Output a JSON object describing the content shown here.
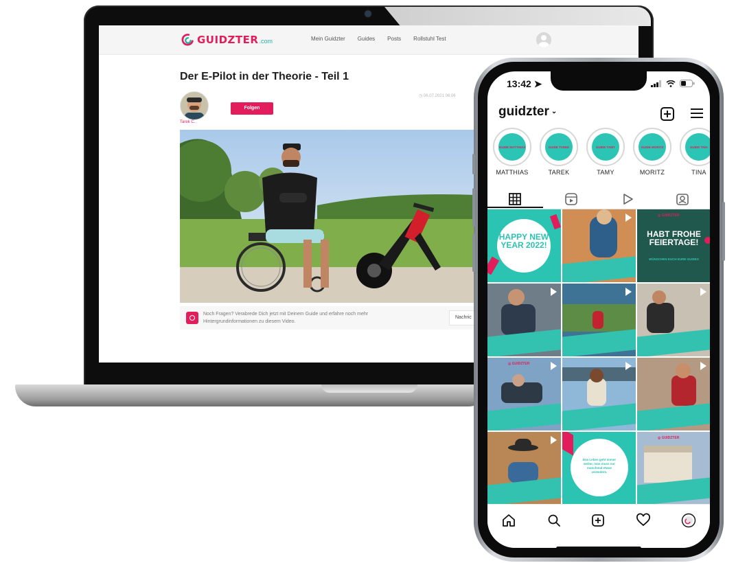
{
  "website": {
    "logo_text": "GUIDZTER",
    "logo_domain": ".com",
    "nav": [
      "Mein Guidzter",
      "Guides",
      "Posts",
      "Rollstuhl Test"
    ],
    "post_title": "Der E-Pilot in der Theorie - Teil 1",
    "post_date": "06.07.2021 06:06",
    "author_name": "Tarek C.",
    "follow_label": "Folgen",
    "info_text": "Noch Fragen? Verabrede Dich jetzt mit Deinem Guide und erfahre noch mehr Hintergrundinformationen zu diesem Video.",
    "message_label": "Nachric"
  },
  "phone": {
    "status_time": "13:42",
    "username": "guidzter",
    "stories": [
      {
        "label": "MATTHIAS",
        "inner": "GUIDE MATTHIAS"
      },
      {
        "label": "TAREK",
        "inner": "GUIDE TAREK"
      },
      {
        "label": "TAMY",
        "inner": "GUIDE TAMY"
      },
      {
        "label": "MORITZ",
        "inner": "GUIDE MORITZ"
      },
      {
        "label": "TINA",
        "inner": "GUIDE TINA"
      }
    ],
    "tiles": [
      {
        "title": "HAPPY NEW YEAR 2022!"
      },
      {
        "caption": ""
      },
      {
        "title": "HABT FROHE FEIERTAGE!",
        "sub": "WÜNSCHEN EUCH EURE GUIDES"
      },
      {
        "caption": ""
      },
      {
        "caption": ""
      },
      {
        "caption": ""
      },
      {
        "caption": ""
      },
      {
        "caption": ""
      },
      {
        "caption": ""
      },
      {
        "caption": ""
      },
      {
        "quote": "Das Leben geht immer weiter, man muss nur manchmal etwas verändern."
      },
      {
        "caption": ""
      }
    ]
  },
  "colors": {
    "brand_pink": "#e11d5c",
    "brand_teal": "#2cc4b4"
  }
}
